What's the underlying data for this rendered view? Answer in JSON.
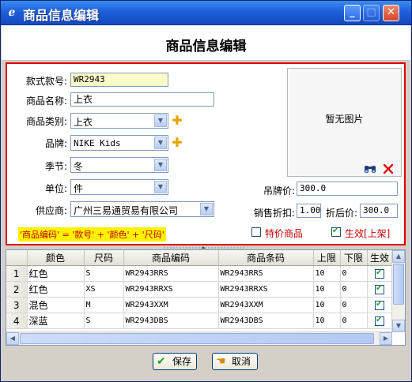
{
  "window": {
    "title": "商品信息编辑"
  },
  "header": {
    "title": "商品信息编辑"
  },
  "form": {
    "style_no_label": "款式款号:",
    "style_no_value": "WR2943",
    "name_label": "商品名称:",
    "name_value": "上衣",
    "category_label": "商品类别:",
    "category_value": "上衣",
    "brand_label": "品牌:",
    "brand_value": "NIKE Kids",
    "season_label": "季节:",
    "season_value": "冬",
    "unit_label": "单位:",
    "unit_value": "件",
    "supplier_label": "供应商:",
    "supplier_value": "广州三易通贸易有限公司",
    "tag_price_label": "吊牌价:",
    "tag_price_value": "300.0",
    "discount_label": "销售折扣:",
    "discount_value": "1.00",
    "after_discount_label": "折后价:",
    "after_discount_value": "300.0",
    "formula_note": "'商品编码' = '款号' + '颜色' + '尺码'",
    "special_price_label": "特价商品",
    "special_price_checked": false,
    "active_label": "生效[上架]",
    "active_checked": true
  },
  "photo": {
    "placeholder": "暂无图片"
  },
  "grid": {
    "columns": [
      "颜色",
      "尺码",
      "商品编码",
      "商品条码",
      "上限",
      "下限",
      "生效"
    ],
    "rows": [
      {
        "no": "1",
        "color": "红色",
        "size": "S",
        "code": "WR2943RRS",
        "barcode": "WR2943RRS",
        "upper": "10",
        "lower": "0",
        "active": true
      },
      {
        "no": "2",
        "color": "红色",
        "size": "XS",
        "code": "WR2943RRXS",
        "barcode": "WR2943RRXS",
        "upper": "10",
        "lower": "0",
        "active": true
      },
      {
        "no": "3",
        "color": "混色",
        "size": "M",
        "code": "WR2943XXM",
        "barcode": "WR2943XXM",
        "upper": "10",
        "lower": "0",
        "active": true
      },
      {
        "no": "4",
        "color": "深蓝",
        "size": "S",
        "code": "WR2943DBS",
        "barcode": "WR2943DBS",
        "upper": "10",
        "lower": "0",
        "active": true
      }
    ]
  },
  "buttons": {
    "save": "保存",
    "cancel": "取消"
  },
  "icons": {
    "app": "app-logo-icon",
    "browse": "binoculars-icon",
    "delete": "red-x-icon",
    "add": "yellow-plus-icon",
    "save": "green-check-icon",
    "cancel": "hand-icon"
  }
}
